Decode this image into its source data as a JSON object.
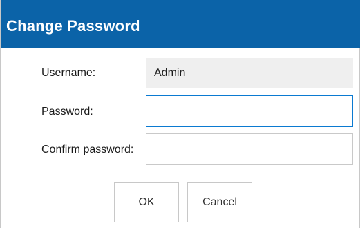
{
  "dialog": {
    "title": "Change Password",
    "colors": {
      "title_bar": "#0b63a8",
      "focus_border": "#0b7ad1"
    }
  },
  "fields": {
    "username": {
      "label": "Username:",
      "value": "Admin"
    },
    "password": {
      "label": "Password:",
      "value": "",
      "focused": true
    },
    "confirm_password": {
      "label": "Confirm password:",
      "value": ""
    }
  },
  "buttons": {
    "ok_label": "OK",
    "cancel_label": "Cancel"
  }
}
